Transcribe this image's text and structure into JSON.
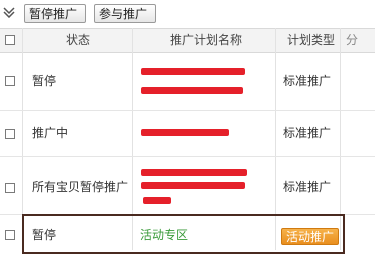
{
  "toolbar": {
    "pause_label": "暂停推广",
    "join_label": "参与推广"
  },
  "table": {
    "headers": {
      "status": "状态",
      "plan_name": "推广计划名称",
      "plan_type": "计划类型",
      "extra": "分"
    },
    "rows": [
      {
        "status": "暂停",
        "plan_type": "标准推广"
      },
      {
        "status": "推广中",
        "plan_type": "标准推广"
      },
      {
        "status": "所有宝贝暂停推广",
        "plan_type": "标准推广"
      },
      {
        "status": "暂停",
        "plan_name": "活动专区",
        "action": "活动推广"
      }
    ]
  }
}
